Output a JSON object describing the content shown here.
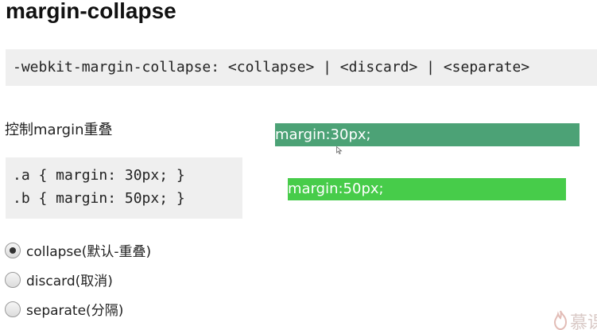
{
  "header": {
    "title": "margin-collapse"
  },
  "syntax": {
    "text": "-webkit-margin-collapse: <collapse> | <discard> | <separate>"
  },
  "section": {
    "subtitle": "控制margin重叠"
  },
  "code": {
    "lines": [
      ".a { margin: 30px; }",
      ".b { margin: 50px; }"
    ]
  },
  "options": {
    "items": [
      {
        "label": "collapse(默认-重叠)",
        "checked": true
      },
      {
        "label": "discard(取消)",
        "checked": false
      },
      {
        "label": "separate(分隔)",
        "checked": false
      }
    ]
  },
  "demo": {
    "box_a_label": "margin:30px;",
    "box_b_label": "margin:50px;",
    "box_a_color": "#4ca276",
    "box_b_color": "#47cc4a"
  },
  "watermark": {
    "text": "慕课",
    "icon": "flame-logo-icon"
  }
}
